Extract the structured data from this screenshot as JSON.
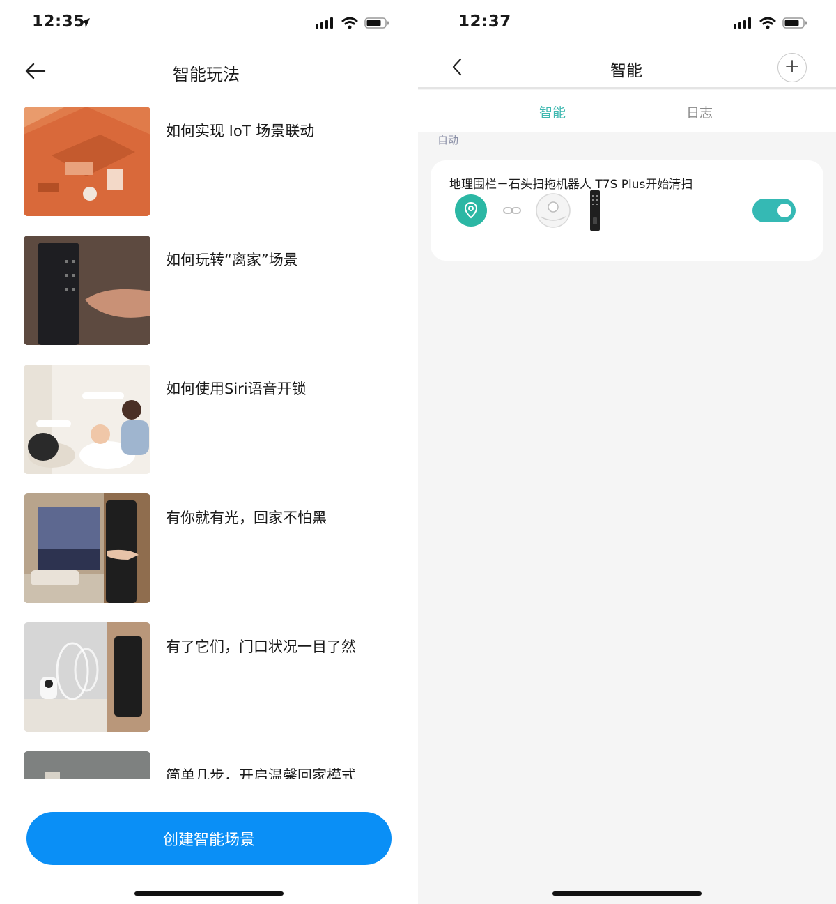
{
  "left_screen": {
    "status": {
      "time": "12:35"
    },
    "header": {
      "title": "智能玩法"
    },
    "guides": [
      {
        "title": "如何实现 IoT 场景联动"
      },
      {
        "title": "如何玩转“离家”场景"
      },
      {
        "title": "如何使用Siri语音开锁"
      },
      {
        "title": "有你就有光，回家不怕黑"
      },
      {
        "title": "有了它们，门口状况一目了然"
      },
      {
        "title": "简单几步，开启温馨回家模式"
      }
    ],
    "create_button": "创建智能场景"
  },
  "right_screen": {
    "status": {
      "time": "12:37"
    },
    "header": {
      "title": "智能"
    },
    "tabs": [
      {
        "label": "智能",
        "active": true
      },
      {
        "label": "日志",
        "active": false
      }
    ],
    "section_label": "自动",
    "scene": {
      "title": "地理围栏－石头扫拖机器人 T7S Plus开始清扫",
      "enabled": true,
      "icons": [
        "location-pin-icon",
        "link-icon",
        "robot-vacuum-icon",
        "smart-lock-icon"
      ]
    }
  },
  "colors": {
    "accent_blue": "#0a8ff6",
    "accent_teal": "#35b9b4",
    "tab_active": "#3fb8b0"
  }
}
